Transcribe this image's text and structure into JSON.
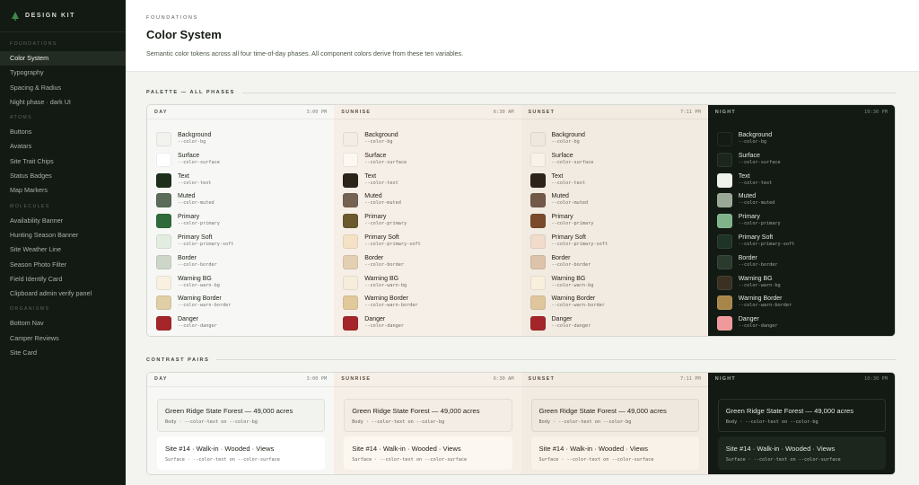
{
  "sidebar": {
    "brand": "DESIGN KIT",
    "groups": [
      {
        "heading": "FOUNDATIONS",
        "items": [
          "Color System",
          "Typography",
          "Spacing & Radius",
          "Night phase · dark UI"
        ]
      },
      {
        "heading": "ATOMS",
        "items": [
          "Buttons",
          "Avatars",
          "Site Trait Chips",
          "Status Badges",
          "Map Markers"
        ]
      },
      {
        "heading": "MOLECULES",
        "items": [
          "Availability Banner",
          "Hunting Season Banner",
          "Site Weather Line",
          "Season Photo Filter",
          "Field Identify Card",
          "Clipboard admin verify panel"
        ]
      },
      {
        "heading": "ORGANISMS",
        "items": [
          "Bottom Nav",
          "Camper Reviews",
          "Site Card"
        ]
      }
    ],
    "active_item": "Color System"
  },
  "header": {
    "eyebrow": "FOUNDATIONS",
    "title": "Color System",
    "description": "Semantic color tokens across all four time-of-day phases. All component colors derive from these ten variables."
  },
  "palette_section": {
    "title": "PALETTE — ALL PHASES"
  },
  "contrast_section": {
    "title": "CONTRAST PAIRS"
  },
  "tokens": [
    {
      "name": "Background",
      "var": "--color-bg"
    },
    {
      "name": "Surface",
      "var": "--color-surface"
    },
    {
      "name": "Text",
      "var": "--color-text"
    },
    {
      "name": "Muted",
      "var": "--color-muted"
    },
    {
      "name": "Primary",
      "var": "--color-primary"
    },
    {
      "name": "Primary Soft",
      "var": "--color-primary-soft"
    },
    {
      "name": "Border",
      "var": "--color-border"
    },
    {
      "name": "Warning BG",
      "var": "--color-warn-bg"
    },
    {
      "name": "Warning Border",
      "var": "--color-warn-border"
    },
    {
      "name": "Danger",
      "var": "--color-danger"
    }
  ],
  "phases": [
    {
      "name": "DAY",
      "time": "3:00 PM",
      "panel_bg": "#f7f8f5",
      "head_color": "#4a5346",
      "text_color": "#1c2218",
      "colors": [
        "#f2f3ef",
        "#ffffff",
        "#1d2e1b",
        "#5b6b59",
        "#2f6b3a",
        "#e3ece0",
        "#cdd6c9",
        "#f8f1e1",
        "#e0cfa6",
        "#a4262a"
      ]
    },
    {
      "name": "SUNRISE",
      "time": "6:30 AM",
      "panel_bg": "#f6efe7",
      "head_color": "#5a4c3e",
      "text_color": "#2a2118",
      "colors": [
        "#f3ede6",
        "#fcf7f1",
        "#2d2419",
        "#766250",
        "#6b5a2e",
        "#f4e2c6",
        "#e5cfb3",
        "#f7eddb",
        "#e1c99c",
        "#a4262a"
      ]
    },
    {
      "name": "SUNSET",
      "time": "7:11 PM",
      "panel_bg": "#f1ebe2",
      "head_color": "#5a4c3e",
      "text_color": "#2a2118",
      "colors": [
        "#efe8df",
        "#f8f2e8",
        "#2d2318",
        "#735a48",
        "#7a4a2b",
        "#f1dccb",
        "#dcc3aa",
        "#f8efdd",
        "#dfc69d",
        "#a4262a"
      ]
    },
    {
      "name": "NIGHT",
      "time": "10:30 PM",
      "panel_bg": "#121a13",
      "head_color": "#aab4a6",
      "text_color": "#e3e8df",
      "colors": [
        "#131b14",
        "#1c261d",
        "#eef2ea",
        "#9aa897",
        "#7fb38a",
        "#1f3326",
        "#2a3a2c",
        "#3a3122",
        "#a8864a",
        "#ef9a9a"
      ]
    }
  ],
  "contrast_pairs": [
    {
      "title": "Green Ridge State Forest — 49,000 acres",
      "caption_role": "Body",
      "caption_pair": "--color-text on --color-bg"
    },
    {
      "title": "Site #14 · Walk-in · Wooded · Views",
      "caption_role": "Surface",
      "caption_pair": "--color-text on --color-surface"
    }
  ],
  "contrast_phase_styles": [
    {
      "card1_bg": "#f2f3ef",
      "card1_border": "#dfe3db",
      "card2_bg": "#ffffff",
      "card2_border": "#ffffff",
      "text": "#1c2218"
    },
    {
      "card1_bg": "#f3ede6",
      "card1_border": "#e5ddd2",
      "card2_bg": "#fcf7f1",
      "card2_border": "#fcf7f1",
      "text": "#2a2118"
    },
    {
      "card1_bg": "#efe8df",
      "card1_border": "#e0d6c9",
      "card2_bg": "#f8f2e8",
      "card2_border": "#f8f2e8",
      "text": "#2a2118"
    },
    {
      "card1_bg": "#131b14",
      "card1_border": "#2a3429",
      "card2_bg": "#1c261d",
      "card2_border": "#1c261d",
      "text": "#e3e8df"
    }
  ]
}
